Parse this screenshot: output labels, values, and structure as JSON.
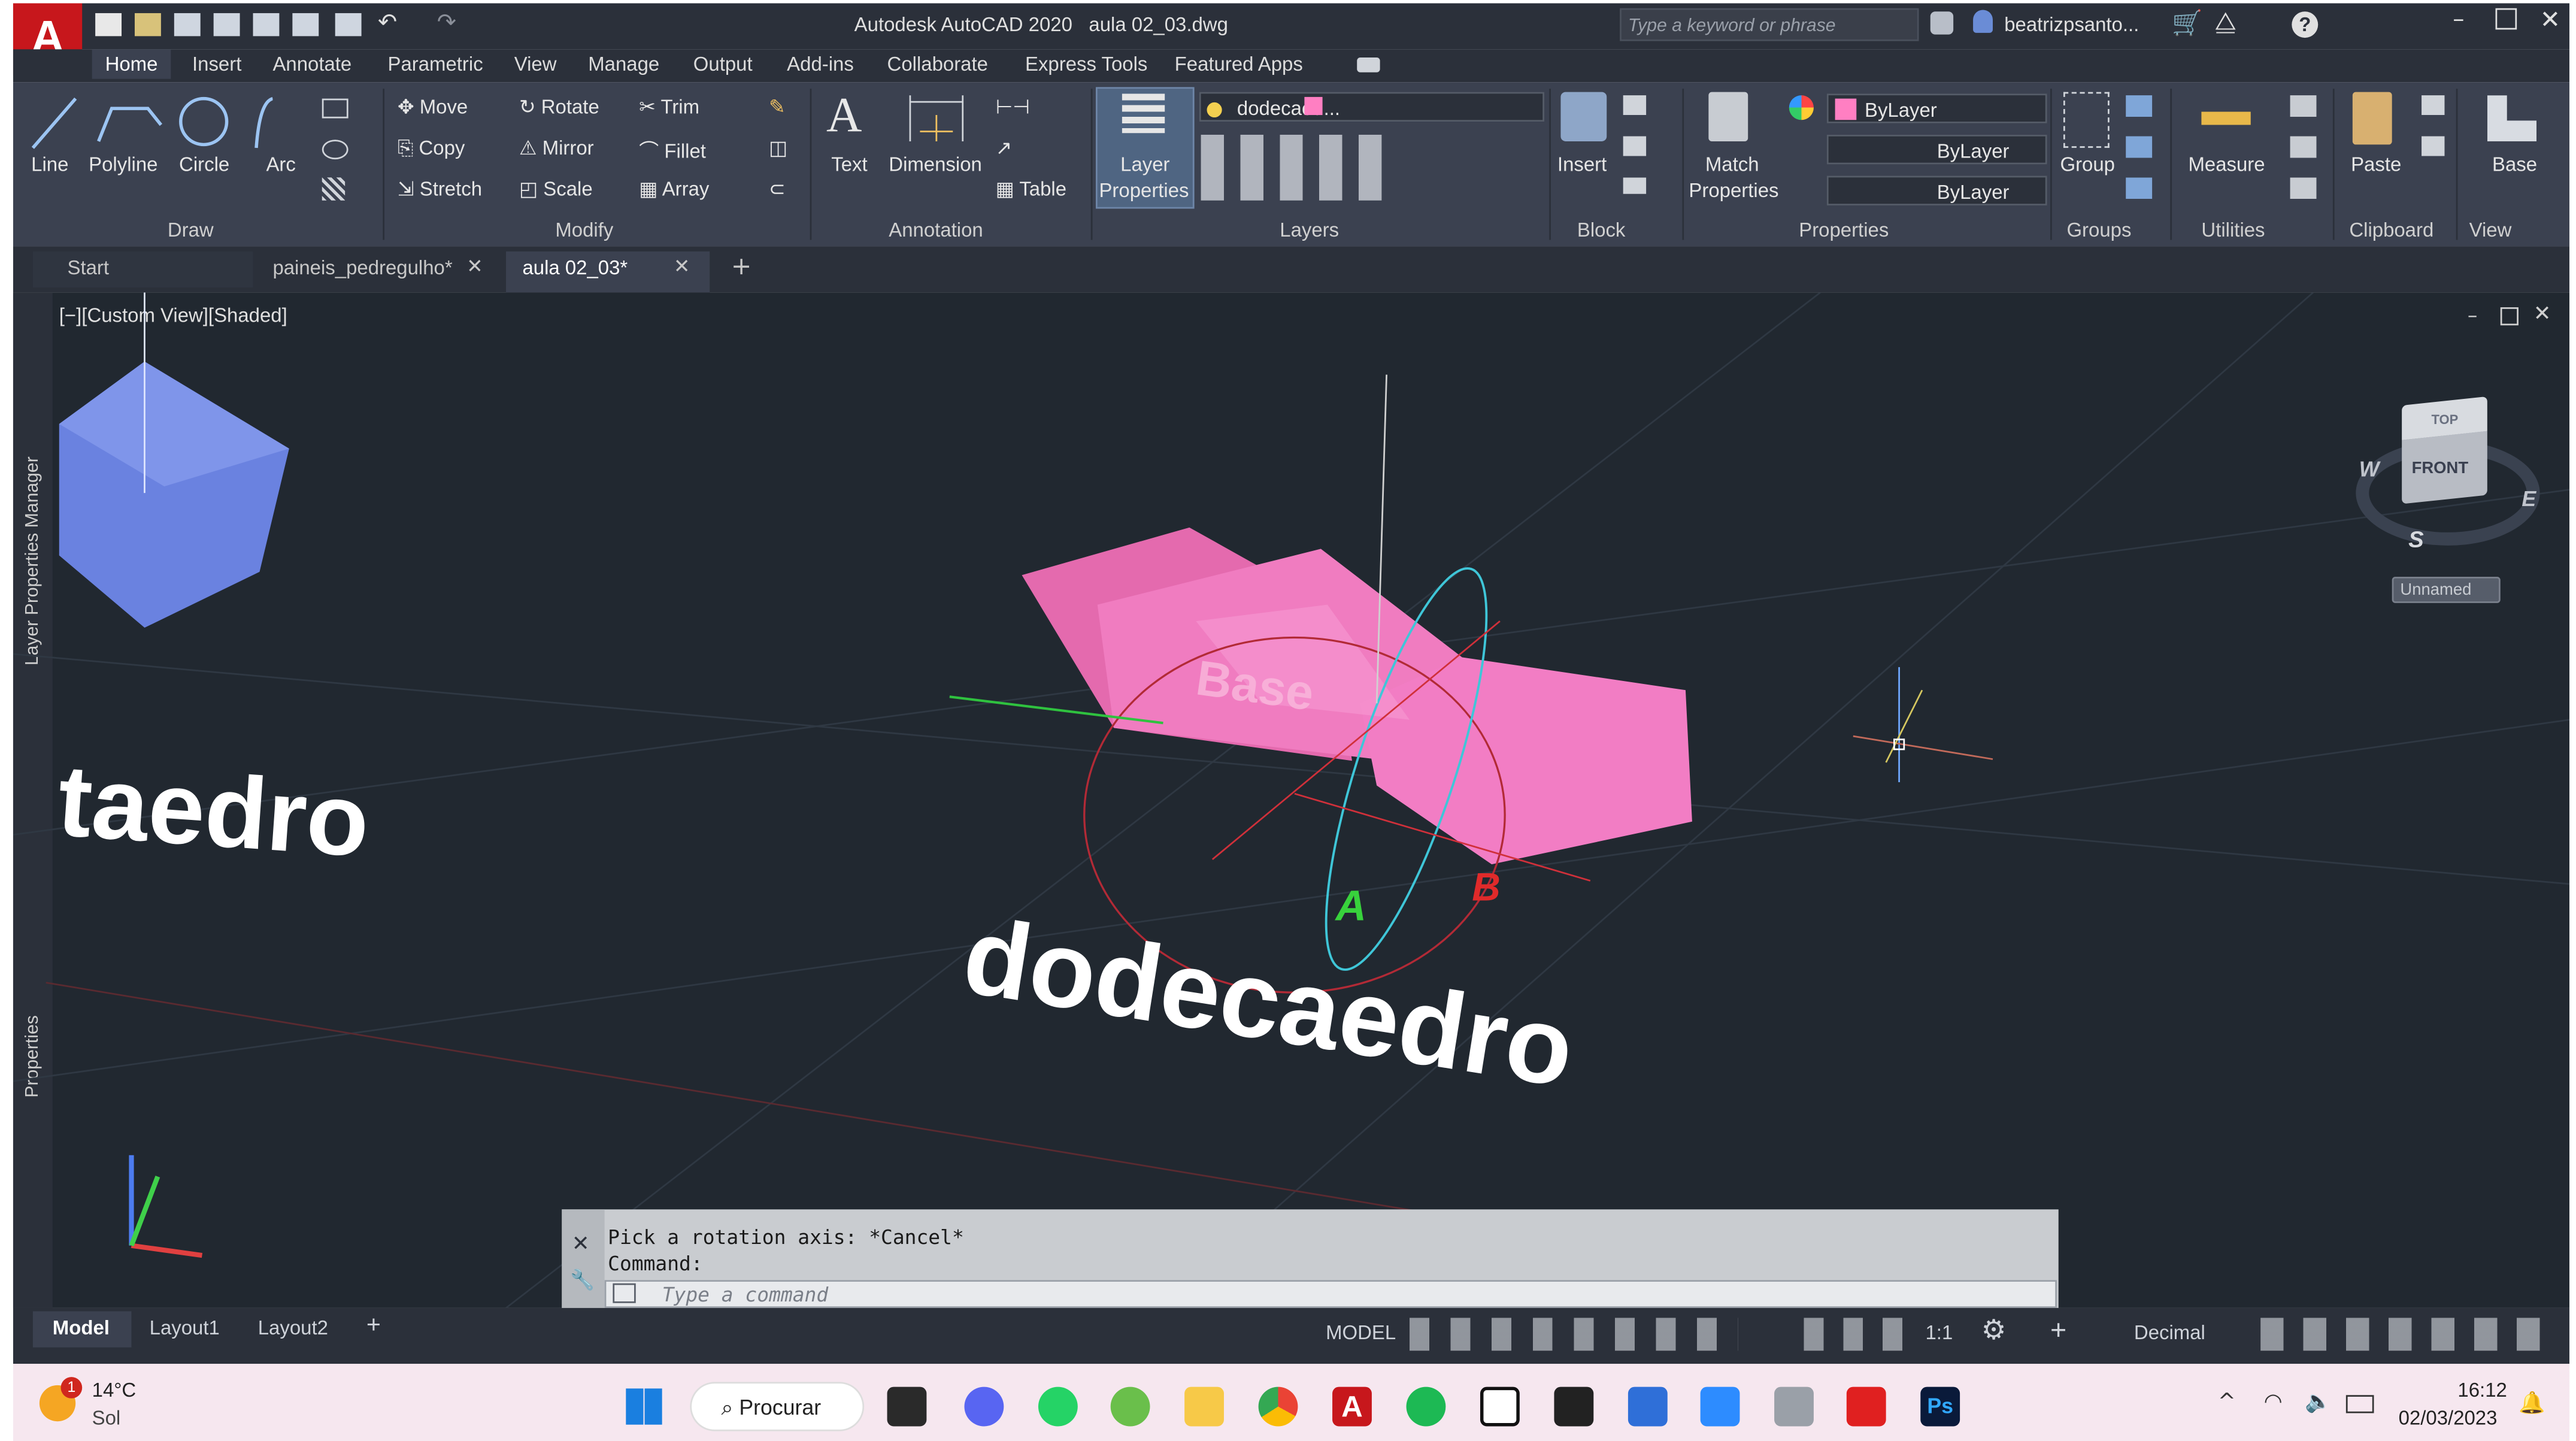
{
  "window": {
    "title": "Autodesk AutoCAD 2020",
    "file": "aula 02_03.dwg",
    "search_placeholder": "Type a keyword or phrase",
    "user": "beatrizpsanto..."
  },
  "app_logo": "A",
  "ribbon_tabs": [
    "Home",
    "Insert",
    "Annotate",
    "Parametric",
    "View",
    "Manage",
    "Output",
    "Add-ins",
    "Collaborate",
    "Express Tools",
    "Featured Apps"
  ],
  "draw": {
    "line": "Line",
    "polyline": "Polyline",
    "circle": "Circle",
    "arc": "Arc",
    "panel": "Draw"
  },
  "modify": {
    "move": "Move",
    "rotate": "Rotate",
    "trim": "Trim",
    "copy": "Copy",
    "mirror": "Mirror",
    "fillet": "Fillet",
    "stretch": "Stretch",
    "scale": "Scale",
    "array": "Array",
    "panel": "Modify"
  },
  "annotation": {
    "text": "Text",
    "dimension": "Dimension",
    "table": "Table",
    "panel": "Annotation"
  },
  "layers": {
    "layer_properties": "Layer",
    "layer_properties2": "Properties",
    "current_layer": "dodecaed...",
    "panel": "Layers"
  },
  "block": {
    "insert": "Insert",
    "panel": "Block"
  },
  "properties": {
    "match": "Match",
    "match2": "Properties",
    "color": "ByLayer",
    "linetype": "ByLayer",
    "lineweight": "ByLayer",
    "panel": "Properties"
  },
  "groups": {
    "group": "Group",
    "panel": "Groups"
  },
  "utilities": {
    "measure": "Measure",
    "panel": "Utilities"
  },
  "clipboard": {
    "paste": "Paste",
    "panel": "Clipboard"
  },
  "view_panel": {
    "base": "Base",
    "panel": "View"
  },
  "doc_tabs": [
    "Start",
    "paineis_pedregulho*",
    "aula 02_03*"
  ],
  "viewport": {
    "label": "[−][Custom View][Shaded]",
    "text1": "taedro",
    "text2": "dodecaedro",
    "face_text": "Base",
    "axis_a": "A",
    "axis_b": "B"
  },
  "viewcube": {
    "top": "TOP",
    "front": "FRONT",
    "w": "W",
    "e": "E",
    "s": "S",
    "ucs": "Unnamed"
  },
  "side_labels": {
    "layer_manager": "Layer Properties Manager",
    "properties": "Properties"
  },
  "command": {
    "line1": "Pick a rotation axis: *Cancel*",
    "line2": "Command:",
    "placeholder": "Type a command"
  },
  "layout_tabs": [
    "Model",
    "Layout1",
    "Layout2"
  ],
  "status": {
    "model": "MODEL",
    "scale": "1:1",
    "units": "Decimal"
  },
  "taskbar": {
    "temp": "14°C",
    "weather": "Sol",
    "search": "Procurar",
    "time": "16:12",
    "date": "02/03/2023",
    "badge": "1"
  },
  "colors": {
    "accent": "#c7171c",
    "layer_color": "#ff7fc2",
    "viewport_bg": "#212830"
  }
}
